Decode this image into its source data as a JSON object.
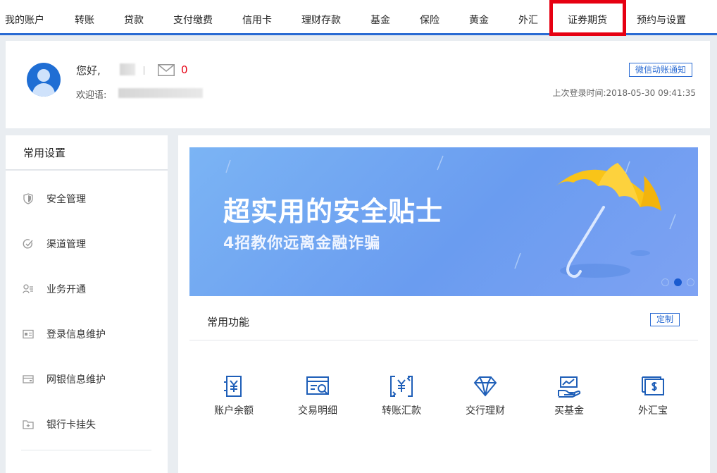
{
  "nav": {
    "items": [
      "我的账户",
      "转账",
      "贷款",
      "支付缴费",
      "信用卡",
      "理财存款",
      "基金",
      "保险",
      "黄金",
      "外汇",
      "证券期货",
      "预约与设置"
    ],
    "highlight_color": "#e60012",
    "accent_color": "#2a6bd3"
  },
  "user": {
    "greeting": "您好,",
    "unread_count": "0",
    "welcome_label": "欢迎语:",
    "wechat_button": "微信动账通知",
    "last_login": "上次登录时间:2018-05-30 09:41:35"
  },
  "sidebar": {
    "title": "常用设置",
    "items": [
      {
        "label": "安全管理",
        "icon": "shield-icon"
      },
      {
        "label": "渠道管理",
        "icon": "channel-icon"
      },
      {
        "label": "业务开通",
        "icon": "user-list-icon"
      },
      {
        "label": "登录信息维护",
        "icon": "id-card-icon"
      },
      {
        "label": "网银信息维护",
        "icon": "card-icon"
      },
      {
        "label": "银行卡挂失",
        "icon": "folder-plus-icon"
      }
    ]
  },
  "banner": {
    "title": "超实用的安全贴士",
    "subtitle": "4招教你远离金融诈骗"
  },
  "functions": {
    "title": "常用功能",
    "customize": "定制",
    "items": [
      {
        "label": "账户余额",
        "icon": "balance-icon"
      },
      {
        "label": "交易明细",
        "icon": "transaction-detail-icon"
      },
      {
        "label": "转账汇款",
        "icon": "transfer-icon"
      },
      {
        "label": "交行理财",
        "icon": "diamond-icon"
      },
      {
        "label": "买基金",
        "icon": "fund-icon"
      },
      {
        "label": "外汇宝",
        "icon": "forex-icon"
      }
    ]
  }
}
